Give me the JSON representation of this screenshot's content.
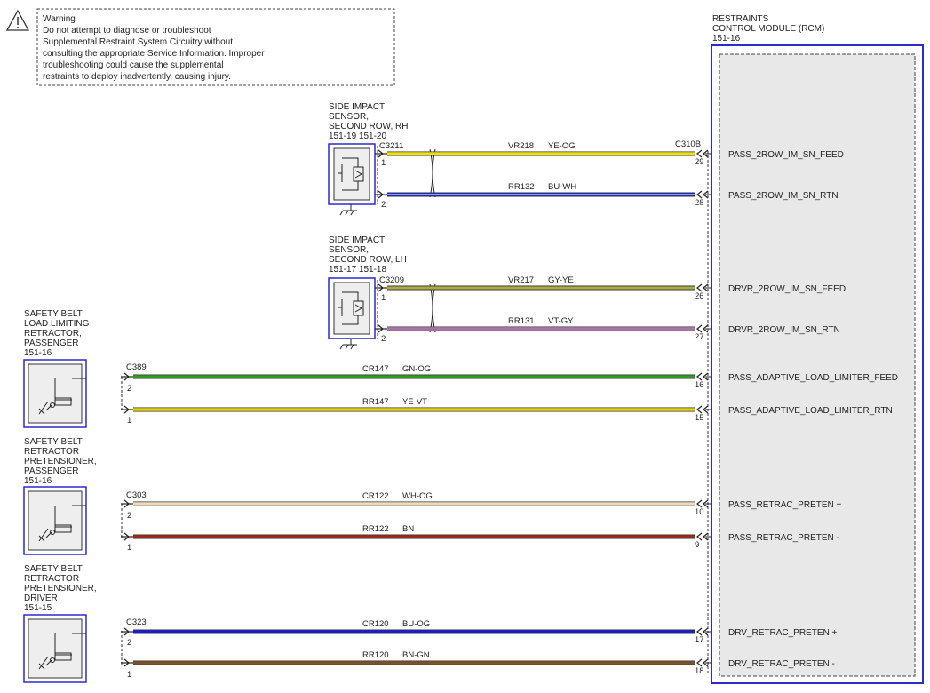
{
  "warning": {
    "icon": "warning-triangle-icon",
    "lines": [
      "Warning",
      "Do not attempt to diagnose or troubleshoot",
      "Supplemental Restraint System Circuitry without",
      "consulting the appropriate Service Information. Improper",
      "troubleshooting could cause the supplemental",
      "restraints to deploy inadvertently, causing injury."
    ]
  },
  "rcm": {
    "title_lines": [
      "RESTRAINTS",
      "CONTROL MODULE (RCM)",
      "151-16"
    ],
    "connector": "C310B"
  },
  "sensors": [
    {
      "id": "rh",
      "title_lines": [
        "SIDE IMPACT",
        "SENSOR,",
        "SECOND ROW, RH",
        "151-19  151-20"
      ],
      "connector": "C3211",
      "pins": [
        "1",
        "2"
      ]
    },
    {
      "id": "lh",
      "title_lines": [
        "SIDE IMPACT",
        "SENSOR,",
        "SECOND ROW, LH",
        "151-17  151-18"
      ],
      "connector": "C3209",
      "pins": [
        "1",
        "2"
      ]
    }
  ],
  "retractors": [
    {
      "id": "load-limit-pass",
      "title_lines": [
        "SAFETY BELT",
        "LOAD LIMITING",
        "RETRACTOR,",
        "PASSENGER",
        "151-16"
      ],
      "connector": "C389",
      "pins": [
        "2",
        "1"
      ]
    },
    {
      "id": "preten-pass",
      "title_lines": [
        "SAFETY BELT",
        "RETRACTOR",
        "PRETENSIONER,",
        "PASSENGER",
        "151-16"
      ],
      "connector": "C303",
      "pins": [
        "2",
        "1"
      ]
    },
    {
      "id": "preten-drv",
      "title_lines": [
        "SAFETY BELT",
        "RETRACTOR",
        "PRETENSIONER,",
        "DRIVER",
        "151-15"
      ],
      "connector": "C323",
      "pins": [
        "2",
        "1"
      ]
    }
  ],
  "wires": [
    {
      "circuit": "VR218",
      "color_code": "YE-OG",
      "rcm_pin": "29",
      "signal": "PASS_2ROW_IM_SN_FEED",
      "color1": "#f2e000",
      "color2": "#f2e000"
    },
    {
      "circuit": "RR132",
      "color_code": "BU-WH",
      "rcm_pin": "28",
      "signal": "PASS_2ROW_IM_SN_RTN",
      "color1": "#1a2ad8",
      "color2": "#d8dcf8"
    },
    {
      "circuit": "VR217",
      "color_code": "GY-YE",
      "rcm_pin": "26",
      "signal": "DRVR_2ROW_IM_SN_FEED",
      "color1": "#8a8a6a",
      "color2": "#c4c400"
    },
    {
      "circuit": "RR131",
      "color_code": "VT-GY",
      "rcm_pin": "27",
      "signal": "DRVR_2ROW_IM_SN_RTN",
      "color1": "#c67ac6",
      "color2": "#8a7a8a"
    },
    {
      "circuit": "CR147",
      "color_code": "GN-OG",
      "rcm_pin": "16",
      "signal": "PASS_ADAPTIVE_LOAD_LIMITER_FEED",
      "color1": "#2e9a1e",
      "color2": "#2e9a1e"
    },
    {
      "circuit": "RR147",
      "color_code": "YE-VT",
      "rcm_pin": "15",
      "signal": "PASS_ADAPTIVE_LOAD_LIMITER_RTN",
      "color1": "#e8d400",
      "color2": "#e8d400"
    },
    {
      "circuit": "CR122",
      "color_code": "WH-OG",
      "rcm_pin": "10",
      "signal": "PASS_RETRAC_PRETEN +",
      "color1": "#f0e0c8",
      "color2": "#f0d8a8"
    },
    {
      "circuit": "RR122",
      "color_code": "BN",
      "rcm_pin": "9",
      "signal": "PASS_RETRAC_PRETEN -",
      "color1": "#9a2a1a",
      "color2": "#9a2a1a"
    },
    {
      "circuit": "CR120",
      "color_code": "BU-OG",
      "rcm_pin": "17",
      "signal": "DRV_RETRAC_PRETEN +",
      "color1": "#1a1ad0",
      "color2": "#1a1ad0"
    },
    {
      "circuit": "RR120",
      "color_code": "BN-GN",
      "rcm_pin": "18",
      "signal": "DRV_RETRAC_PRETEN -",
      "color1": "#8a4a2a",
      "color2": "#6a5a2a"
    }
  ],
  "colors": {
    "module_border": "#2a2ad0",
    "line": "#222222",
    "module_fill": "#e8e8e8"
  }
}
